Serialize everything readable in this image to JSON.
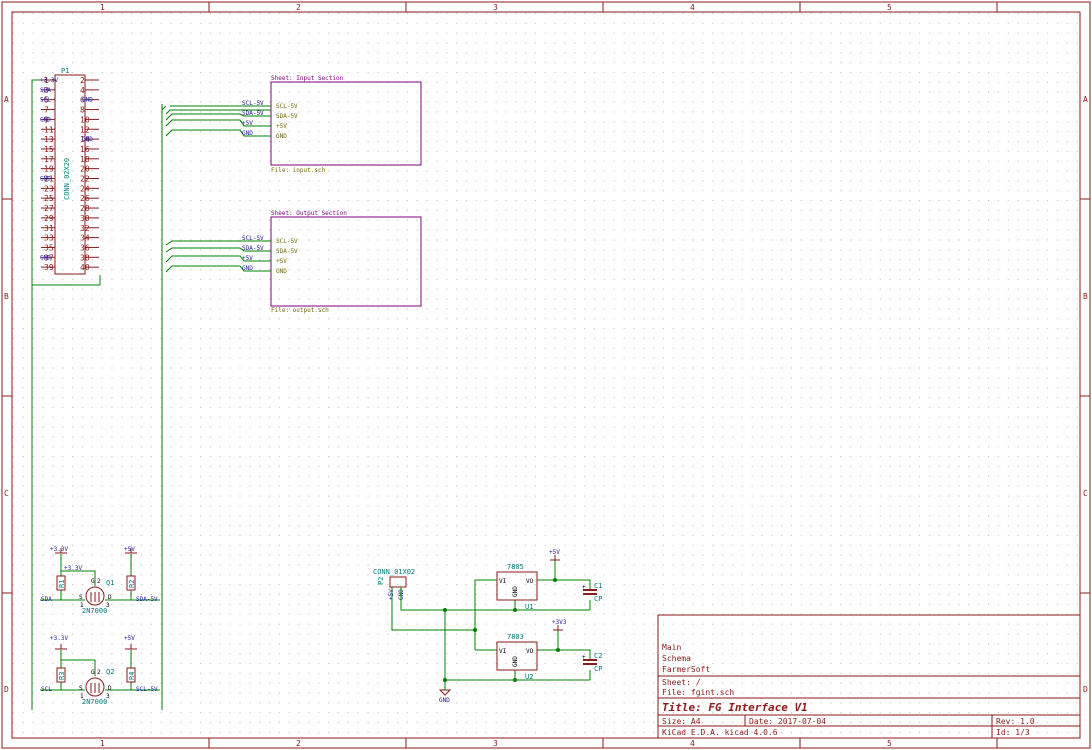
{
  "frame": {
    "columns": [
      "1",
      "2",
      "3",
      "4",
      "5"
    ],
    "rows": [
      "A",
      "B",
      "C",
      "D"
    ]
  },
  "connector_p1": {
    "ref": "P1",
    "value": "CONN_02X20",
    "net_labels_left": [
      "+3.3V",
      "SDA",
      "SCL",
      "",
      "GND",
      "",
      "",
      "",
      "",
      "",
      "GND",
      "",
      "",
      "",
      "",
      "",
      "",
      "",
      "GND",
      "",
      ""
    ],
    "net_labels_right": [
      "",
      "",
      "GND",
      "",
      "",
      "",
      "GND",
      "",
      "",
      "",
      "",
      "",
      "",
      "",
      "",
      "",
      "",
      "",
      "",
      "",
      ""
    ],
    "left_pins": [
      "1",
      "3",
      "5",
      "7",
      "9",
      "11",
      "13",
      "15",
      "17",
      "19",
      "21",
      "23",
      "25",
      "27",
      "29",
      "31",
      "33",
      "35",
      "37",
      "39"
    ],
    "right_pins": [
      "2",
      "4",
      "6",
      "8",
      "10",
      "12",
      "14",
      "16",
      "18",
      "20",
      "22",
      "24",
      "26",
      "28",
      "30",
      "32",
      "34",
      "36",
      "38",
      "40"
    ]
  },
  "sheet_input": {
    "title": "Sheet: Input Section",
    "file": "File: input.sch",
    "pins": [
      "SCL-5V",
      "SDA-5V",
      "+5V",
      "GND"
    ],
    "wire_labels": [
      "SCL-5V",
      "SDA-5V",
      "+5V",
      "GND"
    ]
  },
  "sheet_output": {
    "title": "Sheet: Output Section",
    "file": "File: output.sch",
    "pins": [
      "SCL-5V",
      "SDA-5V",
      "+5V",
      "GND"
    ],
    "wire_labels": [
      "SCL-5V",
      "SDA-5V",
      "+5V",
      "GND"
    ]
  },
  "level_shifter_1": {
    "pwr_left": "+3.3V",
    "pwr_left_net": "+3.3V",
    "pwr_right": "+5V",
    "r_left": "R1",
    "r_right": "R2",
    "ref": "Q1",
    "value": "2N7000",
    "net_left": "SDA",
    "net_right": "SDA-5V",
    "pins": [
      "S",
      "D",
      "G",
      "1",
      "3",
      "2"
    ]
  },
  "level_shifter_2": {
    "pwr_left": "+3.3V",
    "pwr_right": "+5V",
    "r_left": "R3",
    "r_right": "R4",
    "ref": "Q2",
    "value": "2N7000",
    "net_left": "SCL",
    "net_right": "SCL-5V",
    "pins": [
      "S",
      "D",
      "G",
      "1",
      "3",
      "2"
    ]
  },
  "conn_p2": {
    "value": "CONN_01X02",
    "ref": "P2",
    "pin_labels": [
      "+5V",
      "GND"
    ]
  },
  "regulators": [
    {
      "value": "7805",
      "ref": "U1",
      "vi": "VI",
      "vo": "VO",
      "gnd": "GND",
      "out_net": "+5V",
      "cap_ref": "C1",
      "cap_val": "CP"
    },
    {
      "value": "7803",
      "ref": "U2",
      "vi": "VI",
      "vo": "VO",
      "gnd": "GND",
      "out_net": "+3V3",
      "cap_ref": "C2",
      "cap_val": "CP"
    }
  ],
  "gnd_symbol": "GND",
  "title_block": {
    "lines": [
      "Main",
      "Schema",
      "FarmerSoft"
    ],
    "sheet": "Sheet: /",
    "file": "File: fgint.sch",
    "title": "Title: FG Interface V1",
    "size": "Size: A4",
    "date": "Date: 2017-07-04",
    "rev": "Rev: 1.0",
    "kicad": "KiCad E.D.A.  kicad 4.0.6",
    "id": "Id: 1/3"
  },
  "colors": {
    "frame": "#8b1a1a",
    "wire": "#008000",
    "sheet_border": "#800080",
    "component": "#8b1a1a",
    "net_label": "#1a1a9c",
    "ref_text": "#007b7b"
  }
}
